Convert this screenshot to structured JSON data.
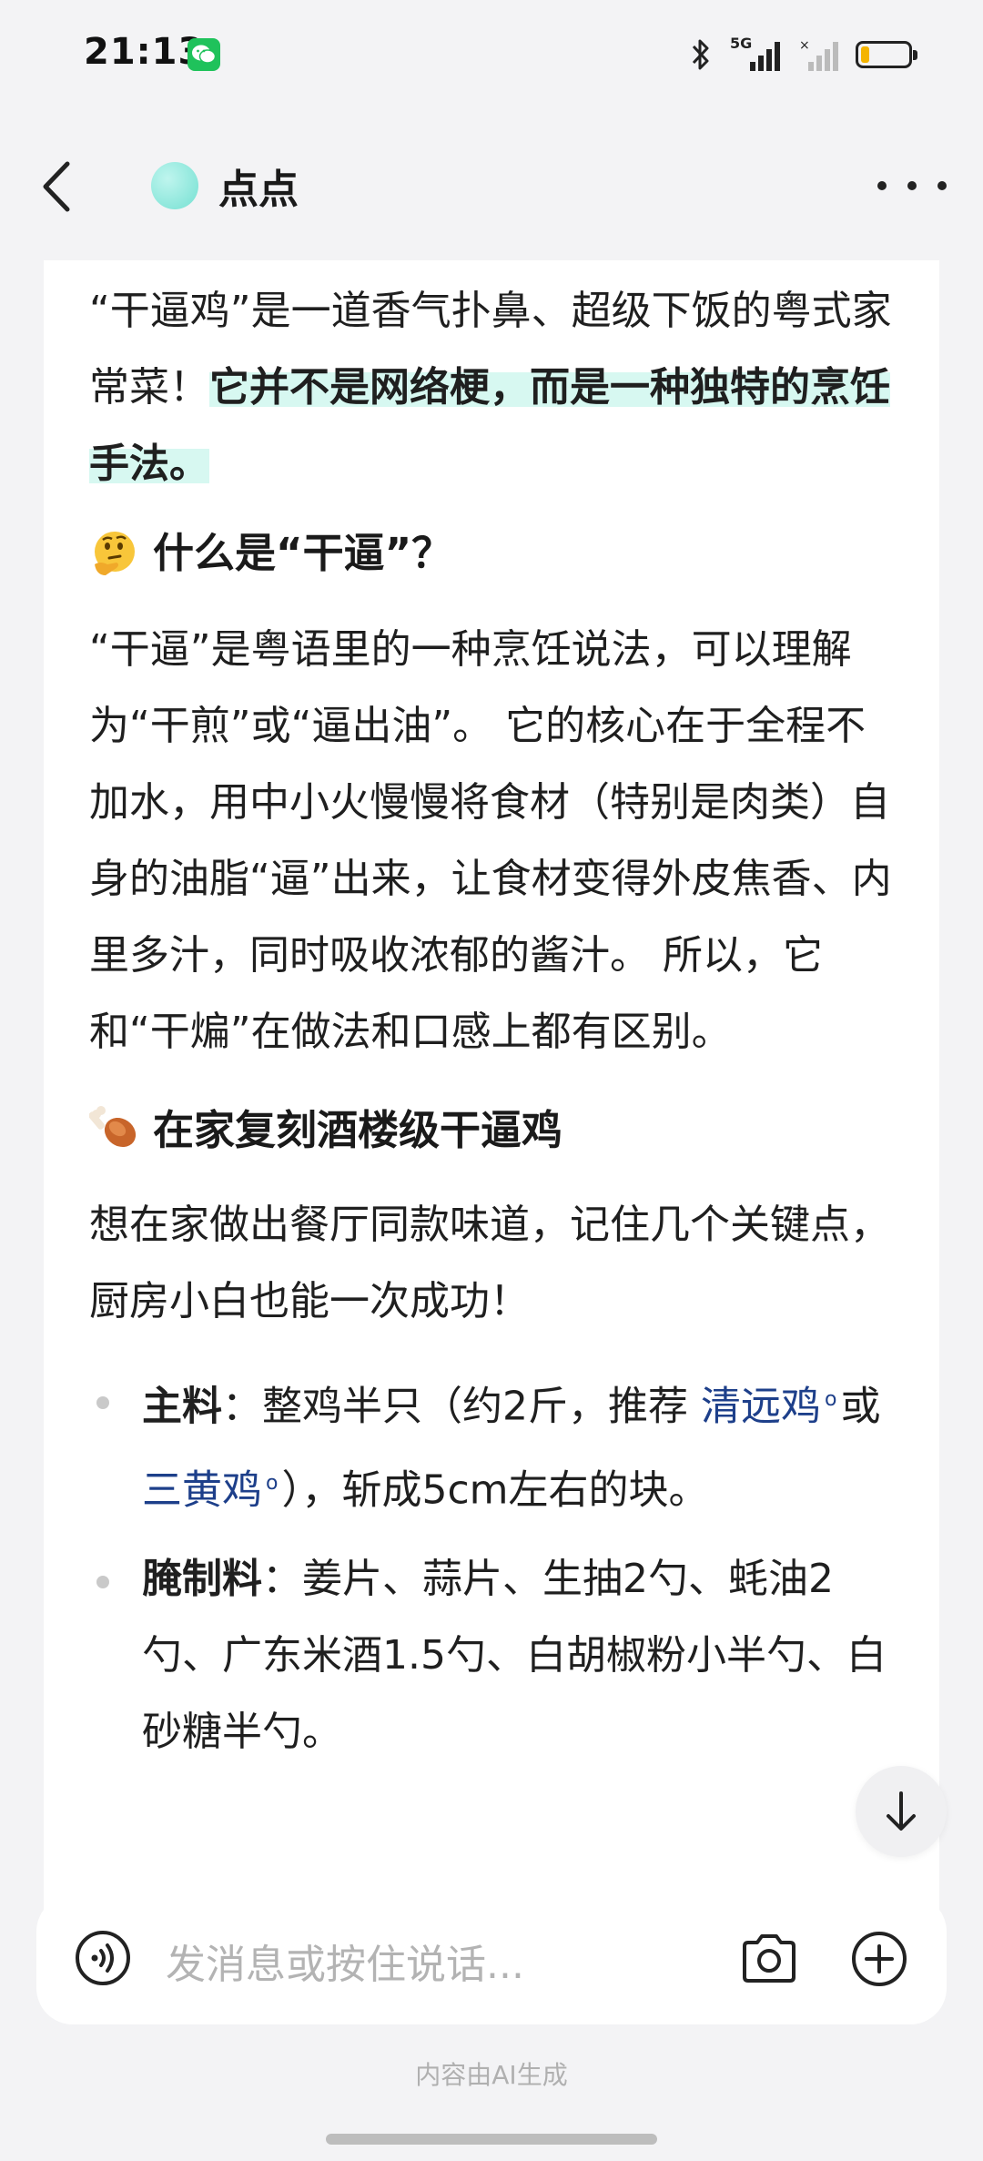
{
  "status_bar": {
    "time": "21:13",
    "network": "5G",
    "icons": [
      "wechat-icon",
      "bluetooth-icon",
      "signal-icon",
      "battery-icon"
    ],
    "battery_color": "#f4b400"
  },
  "header": {
    "title": "点点",
    "back_icon": "chevron-left-icon",
    "more_icon": "ellipsis-icon"
  },
  "message": {
    "intro_before": "“干逼鸡”是一道香气扑鼻、超级下饭的粤式家常菜！",
    "intro_highlight": "它并不是网络梗，而是一种独特的烹饪手法。",
    "section1": {
      "emoji": "thinking-face-emoji",
      "heading": "什么是“干逼”？",
      "body": "“干逼”是粤语里的一种烹饪说法，可以理解为“干煎”或“逼出油”。 它的核心在于全程不加水，用中小火慢慢将食材（特别是肉类）自身的油脂“逼”出来，让食材变得外皮焦香、内里多汁，同时吸收浓郁的酱汁。 所以，它和“干煸”在做法和口感上都有区别。"
    },
    "section2": {
      "emoji": "poultry-leg-emoji",
      "heading": "在家复刻酒楼级干逼鸡",
      "body": "想在家做出餐厅同款味道，记住几个关键点，厨房小白也能一次成功！",
      "items": [
        {
          "label": "主料",
          "sep": "：",
          "text_a": "整鸡半只（约2斤，推荐 ",
          "link1": "清远鸡",
          "text_b": "或 ",
          "link2": "三黄鸡",
          "text_c": "），斩成5cm左右的块。"
        },
        {
          "label": "腌制料",
          "sep": "：",
          "text": "姜片、蒜片、生抽2勺、蚝油2勺、广东米酒1.5勺、白胡椒粉小半勺、白砂糖半勺。"
        }
      ]
    }
  },
  "scroll_button_icon": "arrow-down-icon",
  "input": {
    "placeholder": "发消息或按住说话...",
    "voice_icon": "voice-icon",
    "camera_icon": "camera-icon",
    "add_icon": "plus-circle-icon"
  },
  "footer_note": "内容由AI生成",
  "colors": {
    "highlight": "#d7f8f1",
    "link": "#1d3f8a",
    "brand": "#74e0d2"
  }
}
